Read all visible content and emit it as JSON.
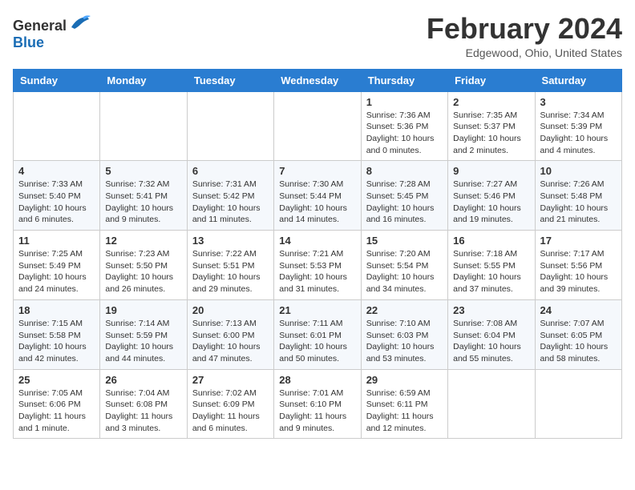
{
  "header": {
    "logo": {
      "text_general": "General",
      "text_blue": "Blue"
    },
    "title": "February 2024",
    "subtitle": "Edgewood, Ohio, United States"
  },
  "calendar": {
    "columns": [
      "Sunday",
      "Monday",
      "Tuesday",
      "Wednesday",
      "Thursday",
      "Friday",
      "Saturday"
    ],
    "rows": [
      [
        {
          "day": "",
          "info": ""
        },
        {
          "day": "",
          "info": ""
        },
        {
          "day": "",
          "info": ""
        },
        {
          "day": "",
          "info": ""
        },
        {
          "day": "1",
          "info": "Sunrise: 7:36 AM\nSunset: 5:36 PM\nDaylight: 10 hours\nand 0 minutes."
        },
        {
          "day": "2",
          "info": "Sunrise: 7:35 AM\nSunset: 5:37 PM\nDaylight: 10 hours\nand 2 minutes."
        },
        {
          "day": "3",
          "info": "Sunrise: 7:34 AM\nSunset: 5:39 PM\nDaylight: 10 hours\nand 4 minutes."
        }
      ],
      [
        {
          "day": "4",
          "info": "Sunrise: 7:33 AM\nSunset: 5:40 PM\nDaylight: 10 hours\nand 6 minutes."
        },
        {
          "day": "5",
          "info": "Sunrise: 7:32 AM\nSunset: 5:41 PM\nDaylight: 10 hours\nand 9 minutes."
        },
        {
          "day": "6",
          "info": "Sunrise: 7:31 AM\nSunset: 5:42 PM\nDaylight: 10 hours\nand 11 minutes."
        },
        {
          "day": "7",
          "info": "Sunrise: 7:30 AM\nSunset: 5:44 PM\nDaylight: 10 hours\nand 14 minutes."
        },
        {
          "day": "8",
          "info": "Sunrise: 7:28 AM\nSunset: 5:45 PM\nDaylight: 10 hours\nand 16 minutes."
        },
        {
          "day": "9",
          "info": "Sunrise: 7:27 AM\nSunset: 5:46 PM\nDaylight: 10 hours\nand 19 minutes."
        },
        {
          "day": "10",
          "info": "Sunrise: 7:26 AM\nSunset: 5:48 PM\nDaylight: 10 hours\nand 21 minutes."
        }
      ],
      [
        {
          "day": "11",
          "info": "Sunrise: 7:25 AM\nSunset: 5:49 PM\nDaylight: 10 hours\nand 24 minutes."
        },
        {
          "day": "12",
          "info": "Sunrise: 7:23 AM\nSunset: 5:50 PM\nDaylight: 10 hours\nand 26 minutes."
        },
        {
          "day": "13",
          "info": "Sunrise: 7:22 AM\nSunset: 5:51 PM\nDaylight: 10 hours\nand 29 minutes."
        },
        {
          "day": "14",
          "info": "Sunrise: 7:21 AM\nSunset: 5:53 PM\nDaylight: 10 hours\nand 31 minutes."
        },
        {
          "day": "15",
          "info": "Sunrise: 7:20 AM\nSunset: 5:54 PM\nDaylight: 10 hours\nand 34 minutes."
        },
        {
          "day": "16",
          "info": "Sunrise: 7:18 AM\nSunset: 5:55 PM\nDaylight: 10 hours\nand 37 minutes."
        },
        {
          "day": "17",
          "info": "Sunrise: 7:17 AM\nSunset: 5:56 PM\nDaylight: 10 hours\nand 39 minutes."
        }
      ],
      [
        {
          "day": "18",
          "info": "Sunrise: 7:15 AM\nSunset: 5:58 PM\nDaylight: 10 hours\nand 42 minutes."
        },
        {
          "day": "19",
          "info": "Sunrise: 7:14 AM\nSunset: 5:59 PM\nDaylight: 10 hours\nand 44 minutes."
        },
        {
          "day": "20",
          "info": "Sunrise: 7:13 AM\nSunset: 6:00 PM\nDaylight: 10 hours\nand 47 minutes."
        },
        {
          "day": "21",
          "info": "Sunrise: 7:11 AM\nSunset: 6:01 PM\nDaylight: 10 hours\nand 50 minutes."
        },
        {
          "day": "22",
          "info": "Sunrise: 7:10 AM\nSunset: 6:03 PM\nDaylight: 10 hours\nand 53 minutes."
        },
        {
          "day": "23",
          "info": "Sunrise: 7:08 AM\nSunset: 6:04 PM\nDaylight: 10 hours\nand 55 minutes."
        },
        {
          "day": "24",
          "info": "Sunrise: 7:07 AM\nSunset: 6:05 PM\nDaylight: 10 hours\nand 58 minutes."
        }
      ],
      [
        {
          "day": "25",
          "info": "Sunrise: 7:05 AM\nSunset: 6:06 PM\nDaylight: 11 hours\nand 1 minute."
        },
        {
          "day": "26",
          "info": "Sunrise: 7:04 AM\nSunset: 6:08 PM\nDaylight: 11 hours\nand 3 minutes."
        },
        {
          "day": "27",
          "info": "Sunrise: 7:02 AM\nSunset: 6:09 PM\nDaylight: 11 hours\nand 6 minutes."
        },
        {
          "day": "28",
          "info": "Sunrise: 7:01 AM\nSunset: 6:10 PM\nDaylight: 11 hours\nand 9 minutes."
        },
        {
          "day": "29",
          "info": "Sunrise: 6:59 AM\nSunset: 6:11 PM\nDaylight: 11 hours\nand 12 minutes."
        },
        {
          "day": "",
          "info": ""
        },
        {
          "day": "",
          "info": ""
        }
      ]
    ]
  }
}
